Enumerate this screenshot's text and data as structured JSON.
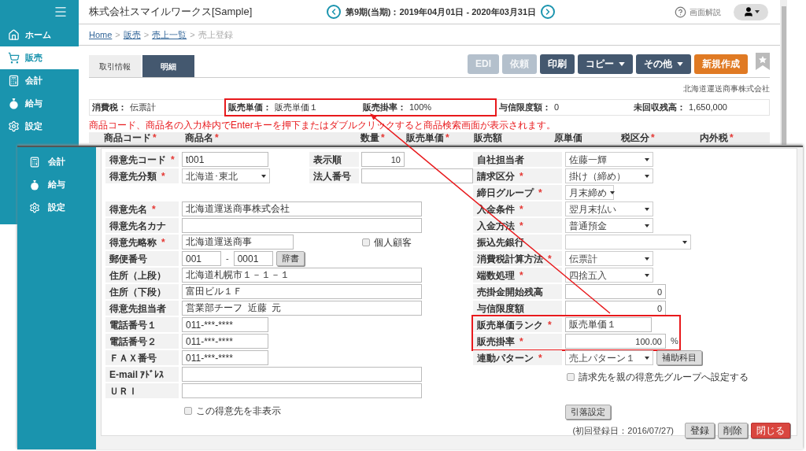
{
  "sidebar": {
    "items": [
      {
        "label": "ホーム",
        "selected": false
      },
      {
        "label": "販売",
        "selected": true
      },
      {
        "label": "会計",
        "selected": false
      },
      {
        "label": "給与",
        "selected": false
      },
      {
        "label": "設定",
        "selected": false
      }
    ]
  },
  "header": {
    "company": "株式会社スマイルワークス[Sample]",
    "period": "第9期(当期)：2019年04月01日 - 2020年03月31日",
    "help": "画面解説"
  },
  "breadcrumb": [
    {
      "label": "Home",
      "link": true
    },
    {
      "separator": ">",
      "label": "販売",
      "link": true
    },
    {
      "separator": ">",
      "label": "売上一覧",
      "link": true
    },
    {
      "separator": ">",
      "label": "売上登録",
      "link": false
    }
  ],
  "tabs": [
    {
      "label": "取引情報",
      "selected": false
    },
    {
      "label": "明細",
      "selected": true
    }
  ],
  "actions": [
    {
      "label": "EDI",
      "kind": "normal",
      "disabled": true,
      "dropdown": false
    },
    {
      "label": "依頼",
      "kind": "normal",
      "disabled": true,
      "dropdown": false
    },
    {
      "label": "印刷",
      "kind": "normal",
      "disabled": false,
      "dropdown": false
    },
    {
      "label": "コピー",
      "kind": "normal",
      "disabled": false,
      "dropdown": true
    },
    {
      "label": "その他",
      "kind": "normal",
      "disabled": false,
      "dropdown": true
    },
    {
      "label": "新規作成",
      "kind": "create",
      "disabled": false,
      "dropdown": false
    }
  ],
  "customer": "北海道運送商事株式会社",
  "summary": [
    {
      "label": "消費税：",
      "value": "伝票計",
      "highlighted": false
    },
    {
      "label": "販売単価：",
      "value": "販売単価１",
      "highlighted": true
    },
    {
      "label": "販売掛率：",
      "value": "100%",
      "highlighted": true
    },
    {
      "label": "与信限度額：",
      "value": "0",
      "highlighted": false
    },
    {
      "label": "未回収残高：",
      "value": "1,650,000",
      "highlighted": false
    }
  ],
  "notice": "商品コード、商品名の入力枠内でEnterキーを押下またはダブルクリックすると商品検索画面が表示されます。",
  "table": {
    "columns": [
      {
        "label": "商品コード",
        "required_mark": "*"
      },
      {
        "label": "商品名",
        "required_mark": "*"
      },
      {
        "label": "数量",
        "required_mark": "*"
      },
      {
        "label": "販売単価",
        "required_mark": "*"
      },
      {
        "label": "販売額"
      },
      {
        "label": "原単価"
      },
      {
        "label": "税区分",
        "required_mark": "*"
      },
      {
        "label": "内外税",
        "required_mark": "*"
      }
    ]
  },
  "overlay_sidebar": {
    "items": [
      {
        "label": "会計"
      },
      {
        "label": "給与"
      },
      {
        "label": "設定"
      }
    ]
  },
  "form": {
    "left_groups": [
      [
        {
          "label": "得意先コード",
          "required_mark": "*",
          "controls": [
            {
              "kind": "text_s",
              "value": "t001"
            }
          ],
          "side": {
            "kind": "field",
            "label": "表示順",
            "control": {
              "kind": "number_s",
              "value": "10"
            }
          }
        },
        {
          "label": "得意先分類",
          "required_mark": "*",
          "controls": [
            {
              "kind": "select",
              "value": "北海道･東北"
            }
          ],
          "side": {
            "kind": "field",
            "label": "法人番号",
            "control": {
              "kind": "text_m"
            }
          }
        }
      ],
      [
        {
          "label": "得意先名",
          "required_mark": "*",
          "controls": [
            {
              "kind": "text_l",
              "value": "北海道運送商事株式会社"
            }
          ]
        },
        {
          "label": "得意先名カナ",
          "controls": [
            {
              "kind": "text_l"
            }
          ]
        },
        {
          "label": "得意先略称",
          "required_mark": "*",
          "controls": [
            {
              "kind": "text_m",
              "value": "北海道運送商事"
            }
          ],
          "side": {
            "kind": "checkbox",
            "label": "個人顧客",
            "checked": false
          }
        },
        {
          "label": "郵便番号",
          "controls": [
            {
              "kind": "text_xs",
              "value": "001"
            },
            {
              "kind": "separator",
              "text": "-"
            },
            {
              "kind": "text_xs",
              "value": "0001"
            },
            {
              "kind": "button",
              "label": "辞書"
            }
          ]
        },
        {
          "label": "住所（上段）",
          "controls": [
            {
              "kind": "text_l",
              "value": "北海道札幌市１－１－１"
            }
          ]
        },
        {
          "label": "住所（下段）",
          "controls": [
            {
              "kind": "text_l",
              "value": "富田ビル１Ｆ"
            }
          ]
        },
        {
          "label": "得意先担当者",
          "controls": [
            {
              "kind": "text_l",
              "value": "営業部チーフ  近藤  元"
            }
          ]
        },
        {
          "label": "電話番号１",
          "controls": [
            {
              "kind": "text_s",
              "value": "011-***-****"
            }
          ]
        },
        {
          "label": "電話番号２",
          "controls": [
            {
              "kind": "text_s",
              "value": "011-***-****"
            }
          ]
        },
        {
          "label": "ＦＡＸ番号",
          "controls": [
            {
              "kind": "text_s",
              "value": "011-***-****"
            }
          ]
        },
        {
          "label": "E-mail ｱﾄﾞﾚｽ",
          "controls": [
            {
              "kind": "text_l"
            }
          ]
        },
        {
          "label": "ＵＲＩ",
          "controls": [
            {
              "kind": "text_l"
            }
          ]
        }
      ]
    ],
    "hide_option": {
      "label": "この得意先を非表示",
      "checked": false
    },
    "right_rows": [
      {
        "label": "自社担当者",
        "controls": [
          {
            "kind": "select",
            "value": "佐藤一輝"
          }
        ]
      },
      {
        "label": "請求区分",
        "required_mark": "*",
        "controls": [
          {
            "kind": "select",
            "value": "掛け（締め）"
          }
        ]
      },
      {
        "label": "締日グループ",
        "required_mark": "*",
        "controls": [
          {
            "kind": "select_s",
            "value": "月末締め"
          }
        ]
      },
      {
        "label": "入金条件",
        "required_mark": "*",
        "controls": [
          {
            "kind": "select",
            "value": "翌月末払い"
          }
        ]
      },
      {
        "label": "入金方法",
        "required_mark": "*",
        "controls": [
          {
            "kind": "select",
            "value": "普通預金"
          }
        ]
      },
      {
        "label": "振込先銀行",
        "controls": [
          {
            "kind": "select_l"
          }
        ]
      },
      {
        "label": "消費税計算方法",
        "required_mark": "*",
        "controls": [
          {
            "kind": "select",
            "value": "伝票計"
          }
        ]
      },
      {
        "label": "端数処理",
        "required_mark": "*",
        "controls": [
          {
            "kind": "select",
            "value": "四捨五入"
          }
        ]
      },
      {
        "label": "売掛金開始残高",
        "controls": [
          {
            "kind": "number_m",
            "value": "0"
          }
        ]
      },
      {
        "label": "与信限度額",
        "controls": [
          {
            "kind": "number_m",
            "value": "0"
          }
        ]
      },
      {
        "label": "販売単価ランク",
        "required_mark": "*",
        "highlighted": true,
        "controls": [
          {
            "kind": "text_s",
            "value": "販売単価１"
          }
        ]
      },
      {
        "label": "販売掛率",
        "required_mark": "*",
        "highlighted": true,
        "controls": [
          {
            "kind": "number_m",
            "value": "100.00"
          },
          {
            "kind": "separator",
            "text": "%"
          }
        ]
      },
      {
        "label": "連動パターン",
        "required_mark": "*",
        "controls": [
          {
            "kind": "select",
            "value": "売上パターン１"
          },
          {
            "kind": "button",
            "label": "補助科目"
          }
        ]
      }
    ],
    "group_option": {
      "label": "請求先を親の得意先グループへ設定する",
      "checked": false
    },
    "debit_button": "引落設定",
    "registered": "(初回登録日：2016/07/27)",
    "buttons": [
      {
        "label": "登録",
        "kind": "normal"
      },
      {
        "label": "削除",
        "kind": "normal"
      },
      {
        "label": "閉じる",
        "kind": "close"
      }
    ]
  }
}
